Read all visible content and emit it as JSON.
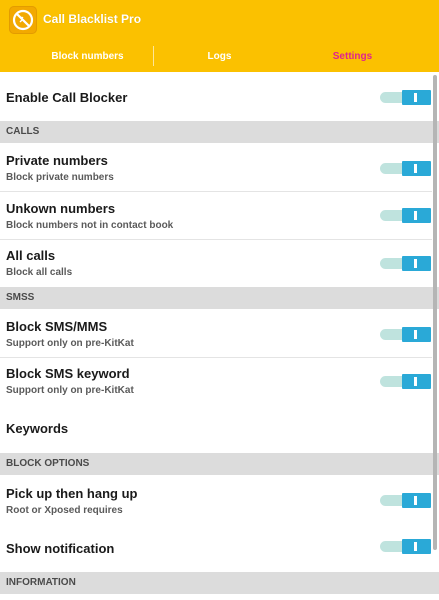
{
  "app": {
    "title": "Call Blacklist Pro"
  },
  "tabs": [
    {
      "label": "Block numbers",
      "selected": false
    },
    {
      "label": "Logs",
      "selected": false
    },
    {
      "label": "Settings",
      "selected": true
    }
  ],
  "settings": {
    "enable": {
      "title": "Enable Call Blocker",
      "on": true
    },
    "calls_header": "CALLS",
    "private": {
      "title": "Private numbers",
      "subtitle": "Block private numbers",
      "on": true
    },
    "unknown": {
      "title": "Unkown numbers",
      "subtitle": "Block numbers not in contact book",
      "on": true
    },
    "all_calls": {
      "title": "All calls",
      "subtitle": "Block all calls",
      "on": true
    },
    "smss_header": "SMSS",
    "block_sms": {
      "title": "Block SMS/MMS",
      "subtitle": "Support only on pre-KitKat",
      "on": true
    },
    "sms_keyword": {
      "title": "Block SMS keyword",
      "subtitle": "Support only on pre-KitKat",
      "on": true
    },
    "keywords": {
      "title": "Keywords"
    },
    "block_options_header": "BLOCK OPTIONS",
    "hang_up": {
      "title": "Pick up then hang up",
      "subtitle": "Root or Xposed requires",
      "on": true
    },
    "notification": {
      "title": "Show notification",
      "on": true
    },
    "information_header": "INFORMATION"
  },
  "colors": {
    "accent": "#fbc100",
    "selected_tab": "#e0248e",
    "toggle": "#2aa9d7"
  }
}
